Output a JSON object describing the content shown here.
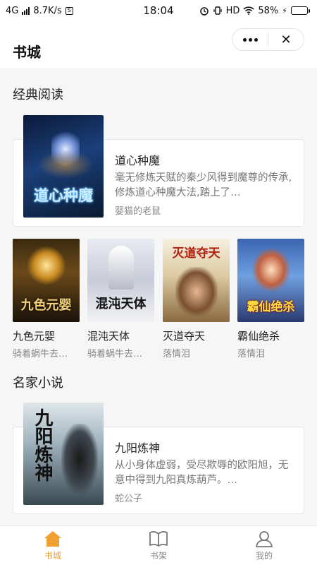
{
  "status_bar": {
    "network": "4G",
    "speed": "8.7K/s",
    "time": "18:04",
    "hd": "HD",
    "battery": "58%",
    "battery_level": 0.58
  },
  "header": {
    "title": "书城"
  },
  "sections": [
    {
      "title": "经典阅读",
      "featured": {
        "title": "道心种魔",
        "description": "毫无修炼天赋的秦少风得到魔尊的传承,修炼道心种魔大法,踏上了…",
        "author": "婴猫的老鼠",
        "cover_text": "道心种魔"
      },
      "books": [
        {
          "title": "九色元婴",
          "author": "骑着蜗牛去…",
          "cover_text": "九色元婴"
        },
        {
          "title": "混沌天体",
          "author": "骑着蜗牛去…",
          "cover_text": "混沌天体"
        },
        {
          "title": "灭道夺天",
          "author": "落情泪",
          "cover_text": "灭道夺天"
        },
        {
          "title": "霸仙绝杀",
          "author": "落情泪",
          "cover_text": "霸仙绝杀"
        }
      ]
    },
    {
      "title": "名家小说",
      "featured": {
        "title": "九阳炼神",
        "description": "从小身体虚弱，受尽欺辱的欧阳旭，无意中得到九阳真炼葫芦。…",
        "author": "蛇公子",
        "cover_text": "九阳炼神"
      }
    }
  ],
  "tabbar": {
    "tabs": [
      {
        "label": "书城",
        "icon": "home-icon",
        "active": true
      },
      {
        "label": "书架",
        "icon": "book-icon",
        "active": false
      },
      {
        "label": "我的",
        "icon": "user-icon",
        "active": false
      }
    ]
  },
  "colors": {
    "accent": "#f0a030",
    "background": "#f6f6f6"
  }
}
